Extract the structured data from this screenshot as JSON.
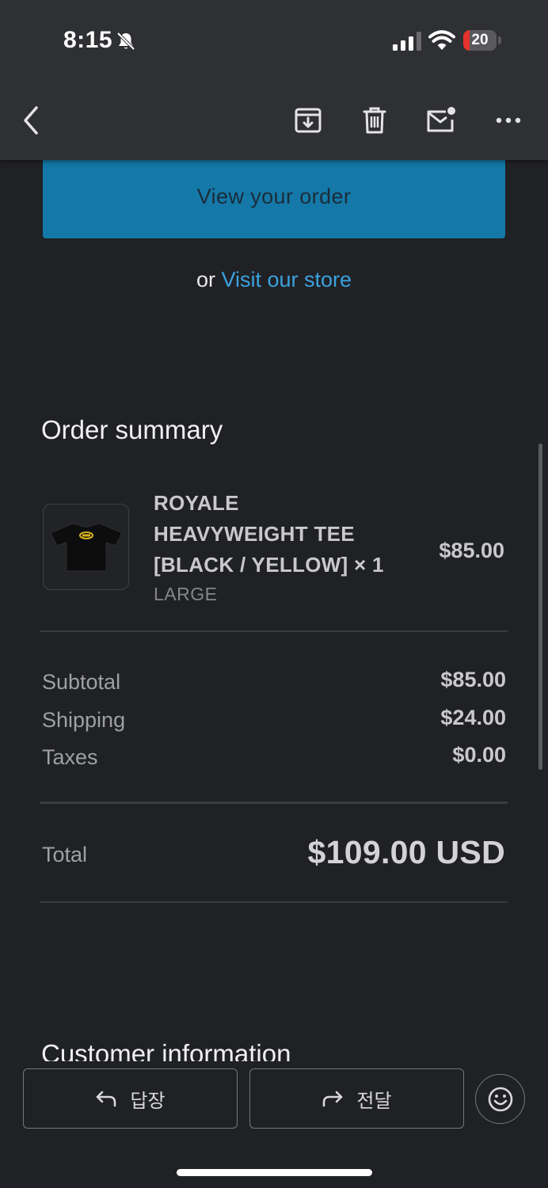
{
  "status_bar": {
    "time": "8:15",
    "battery_level": "20",
    "battery_fraction": 0.2
  },
  "toolbar": {
    "back_icon": "chevron-left-icon",
    "archive_icon": "archive-icon",
    "delete_icon": "trash-icon",
    "mark_unread_icon": "mail-unread-icon",
    "more_icon": "more-horizontal-icon"
  },
  "email": {
    "view_order_label": "View your order",
    "visit_prefix": "or",
    "visit_link": "Visit our store",
    "order_summary_title": "Order summary",
    "product": {
      "name_line1": "ROYALE",
      "name_line2": "HEAVYWEIGHT TEE",
      "name_line3": "[BLACK / YELLOW] × 1",
      "variant": "LARGE",
      "price": "$85.00"
    },
    "costs": [
      {
        "label": "Subtotal",
        "value": "$85.00"
      },
      {
        "label": "Shipping",
        "value": "$24.00"
      },
      {
        "label": "Taxes",
        "value": "$0.00"
      }
    ],
    "total_label": "Total",
    "total_value": "$109.00 USD",
    "next_section_title": "Customer information"
  },
  "bottom_bar": {
    "reply_label": "답장",
    "forward_label": "전달",
    "emoji_icon": "smiley-icon"
  },
  "colors": {
    "background": "#202125",
    "header": "#2f3033",
    "button": "#1479a8",
    "link": "#3aa2dd",
    "battery_low": "#e5322d"
  }
}
